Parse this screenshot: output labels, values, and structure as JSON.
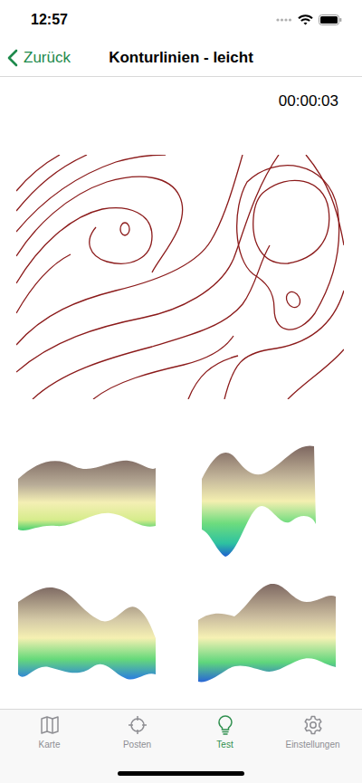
{
  "status_bar": {
    "time": "12:57"
  },
  "nav": {
    "back": "Zurück",
    "title": "Konturlinien - leicht"
  },
  "timer": "00:00:03",
  "tab_bar": [
    {
      "label": "Karte",
      "selected": false
    },
    {
      "label": "Posten",
      "selected": false
    },
    {
      "label": "Test",
      "selected": true
    },
    {
      "label": "Einstellungen",
      "selected": false
    }
  ]
}
